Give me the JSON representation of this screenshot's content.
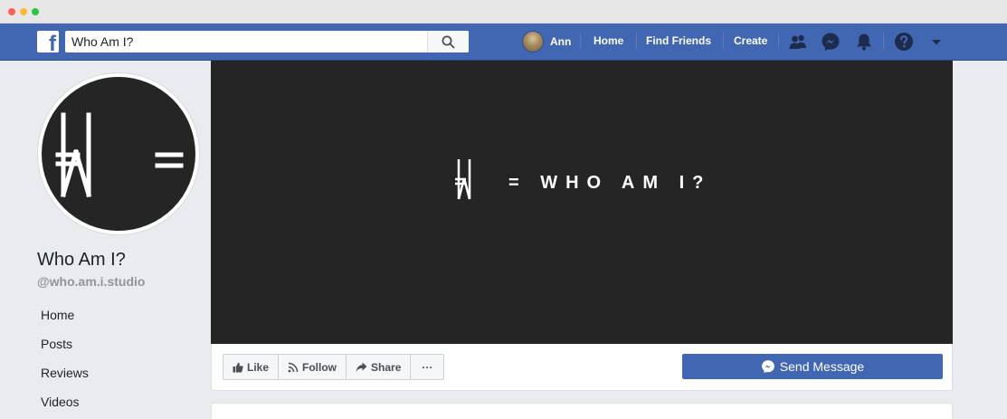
{
  "window": {
    "controls": [
      "close",
      "minimize",
      "maximize"
    ]
  },
  "topbar": {
    "logo_letter": "f",
    "search_value": "Who Am I?",
    "user_name": "Ann",
    "links": [
      "Home",
      "Find Friends",
      "Create"
    ],
    "icons": [
      "friends-icon",
      "messenger-icon",
      "notifications-icon",
      "help-icon",
      "caret-down-icon"
    ]
  },
  "profile": {
    "name": "Who Am I?",
    "handle": "@who.am.i.studio",
    "nav": [
      "Home",
      "Posts",
      "Reviews",
      "Videos"
    ]
  },
  "cover": {
    "text": "= WHO AM I?"
  },
  "actions": {
    "like": "Like",
    "follow": "Follow",
    "share": "Share",
    "more": "···",
    "send_message": "Send Message"
  },
  "colors": {
    "brand": "#4267b2",
    "cover_bg": "#252525",
    "page_bg": "#e9ebee"
  }
}
